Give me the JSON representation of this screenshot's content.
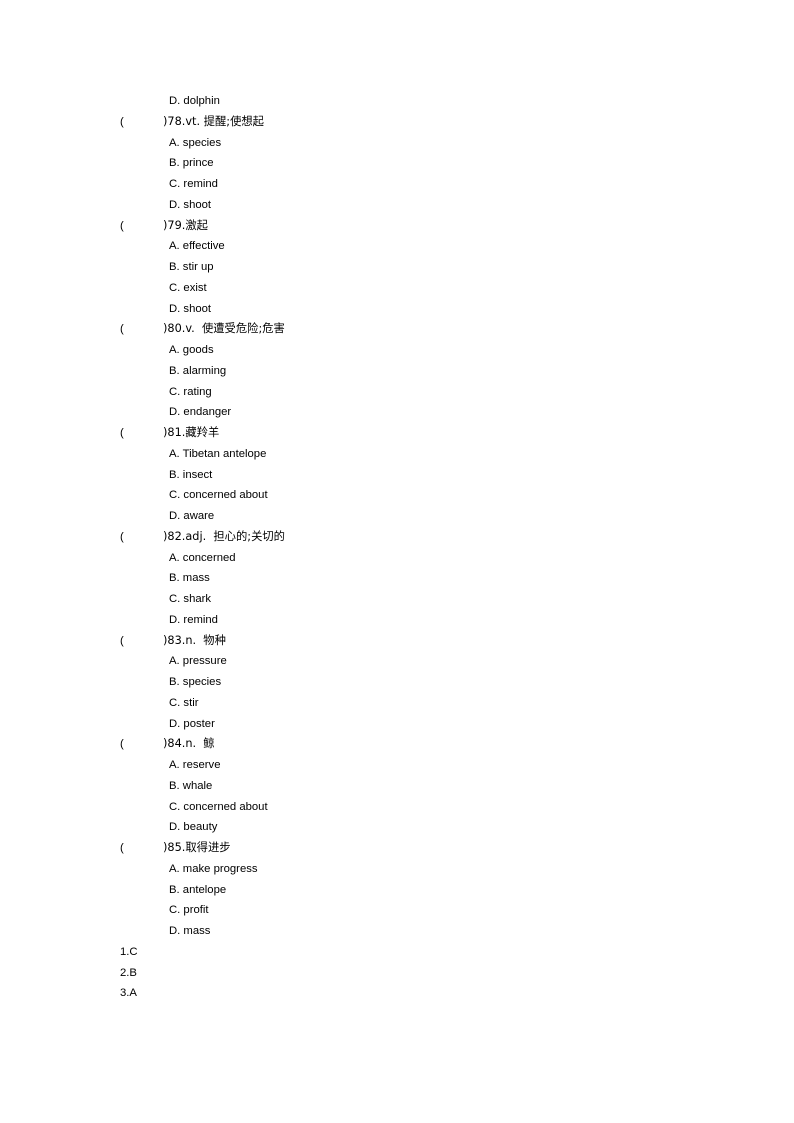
{
  "document": {
    "type": "vocabulary-multiple-choice-worksheet",
    "page_background": "#ffffff",
    "text_color": "#000000"
  },
  "orphan_option": {
    "label": "D.",
    "text": "D. dolphin"
  },
  "questions": [
    {
      "number": "78",
      "paren_open": "(",
      "stem": ")78.vt. 提醒;使想起",
      "options": [
        "A. species",
        "B. prince",
        "C. remind",
        "D. shoot"
      ]
    },
    {
      "number": "79",
      "paren_open": "(",
      "stem": ")79.激起",
      "options": [
        "A. effective",
        "B. stir up",
        "C. exist",
        "D. shoot"
      ]
    },
    {
      "number": "80",
      "paren_open": "(",
      "stem": ")80.v.  使遭受危险;危害",
      "options": [
        "A. goods",
        "B. alarming",
        "C. rating",
        "D. endanger"
      ]
    },
    {
      "number": "81",
      "paren_open": "(",
      "stem": ")81.藏羚羊",
      "options": [
        "A. Tibetan antelope",
        "B. insect",
        "C. concerned about",
        "D. aware"
      ]
    },
    {
      "number": "82",
      "paren_open": "(",
      "stem": ")82.adj.  担心的;关切的",
      "options": [
        "A. concerned",
        "B. mass",
        "C. shark",
        "D. remind"
      ]
    },
    {
      "number": "83",
      "paren_open": "(",
      "stem": ")83.n.  物种",
      "options": [
        "A. pressure",
        "B. species",
        "C. stir",
        "D. poster"
      ]
    },
    {
      "number": "84",
      "paren_open": "(",
      "stem": ")84.n.  鲸",
      "options": [
        "A. reserve",
        "B. whale",
        "C. concerned about",
        "D. beauty"
      ]
    },
    {
      "number": "85",
      "paren_open": "(",
      "stem": ")85.取得进步",
      "options": [
        "A. make progress",
        "B. antelope",
        "C. profit",
        "D. mass"
      ]
    }
  ],
  "answer_key": [
    "1.C",
    "2.B",
    "3.A"
  ]
}
